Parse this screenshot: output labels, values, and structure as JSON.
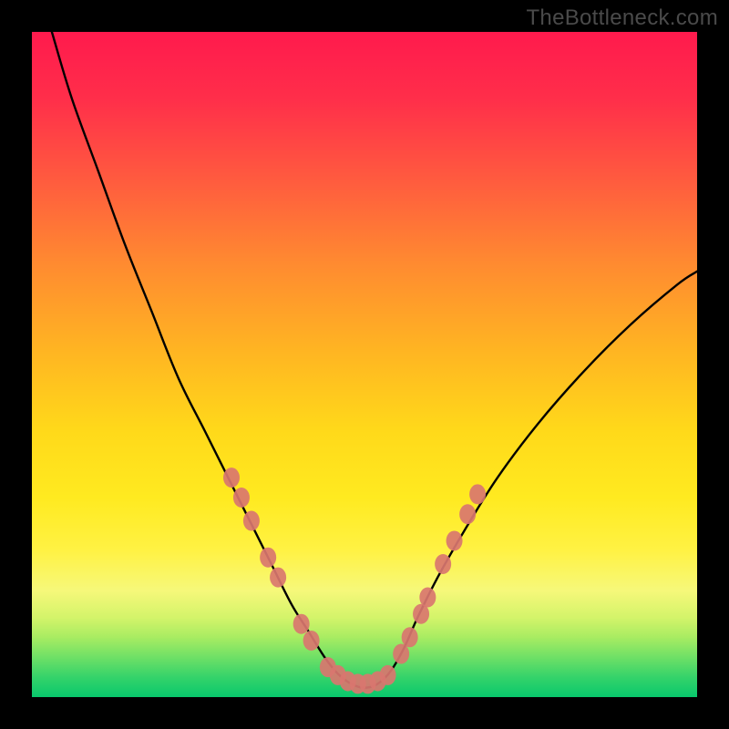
{
  "watermark": "TheBottleneck.com",
  "colors": {
    "frame": "#000000",
    "curve": "#000000",
    "marker_fill": "#d9766f",
    "gradient_top": "#ff1a4d",
    "gradient_bottom": "#08c86c"
  },
  "chart_data": {
    "type": "line",
    "title": "",
    "xlabel": "",
    "ylabel": "",
    "xlim": [
      0,
      100
    ],
    "ylim": [
      0,
      100
    ],
    "note": "No axes or tick labels visible; x/y are normalized 0–100. Curve is a V-shaped bottleneck curve with a cluster of markers near the trough.",
    "series": [
      {
        "name": "bottleneck-curve",
        "x": [
          3,
          6,
          10,
          14,
          18,
          22,
          26,
          30,
          33,
          36,
          39,
          41.5,
          44,
          46,
          48,
          50,
          52,
          54,
          56,
          58,
          61,
          65,
          70,
          76,
          83,
          90,
          97,
          100
        ],
        "y": [
          100,
          90,
          79,
          68,
          58,
          48,
          40,
          32,
          26,
          20,
          14,
          10,
          6,
          3.5,
          2,
          1.4,
          2,
          4,
          7.5,
          12,
          18,
          25,
          33,
          41,
          49,
          56,
          62,
          64
        ]
      }
    ],
    "markers": [
      {
        "x": 30.0,
        "y": 33.0
      },
      {
        "x": 31.5,
        "y": 30.0
      },
      {
        "x": 33.0,
        "y": 26.5
      },
      {
        "x": 35.5,
        "y": 21.0
      },
      {
        "x": 37.0,
        "y": 18.0
      },
      {
        "x": 40.5,
        "y": 11.0
      },
      {
        "x": 42.0,
        "y": 8.5
      },
      {
        "x": 44.5,
        "y": 4.5
      },
      {
        "x": 46.0,
        "y": 3.3
      },
      {
        "x": 47.5,
        "y": 2.4
      },
      {
        "x": 49.0,
        "y": 2.0
      },
      {
        "x": 50.5,
        "y": 2.0
      },
      {
        "x": 52.0,
        "y": 2.4
      },
      {
        "x": 53.5,
        "y": 3.3
      },
      {
        "x": 55.5,
        "y": 6.5
      },
      {
        "x": 56.8,
        "y": 9.0
      },
      {
        "x": 58.5,
        "y": 12.5
      },
      {
        "x": 59.5,
        "y": 15.0
      },
      {
        "x": 61.8,
        "y": 20.0
      },
      {
        "x": 63.5,
        "y": 23.5
      },
      {
        "x": 65.5,
        "y": 27.5
      },
      {
        "x": 67.0,
        "y": 30.5
      }
    ]
  }
}
